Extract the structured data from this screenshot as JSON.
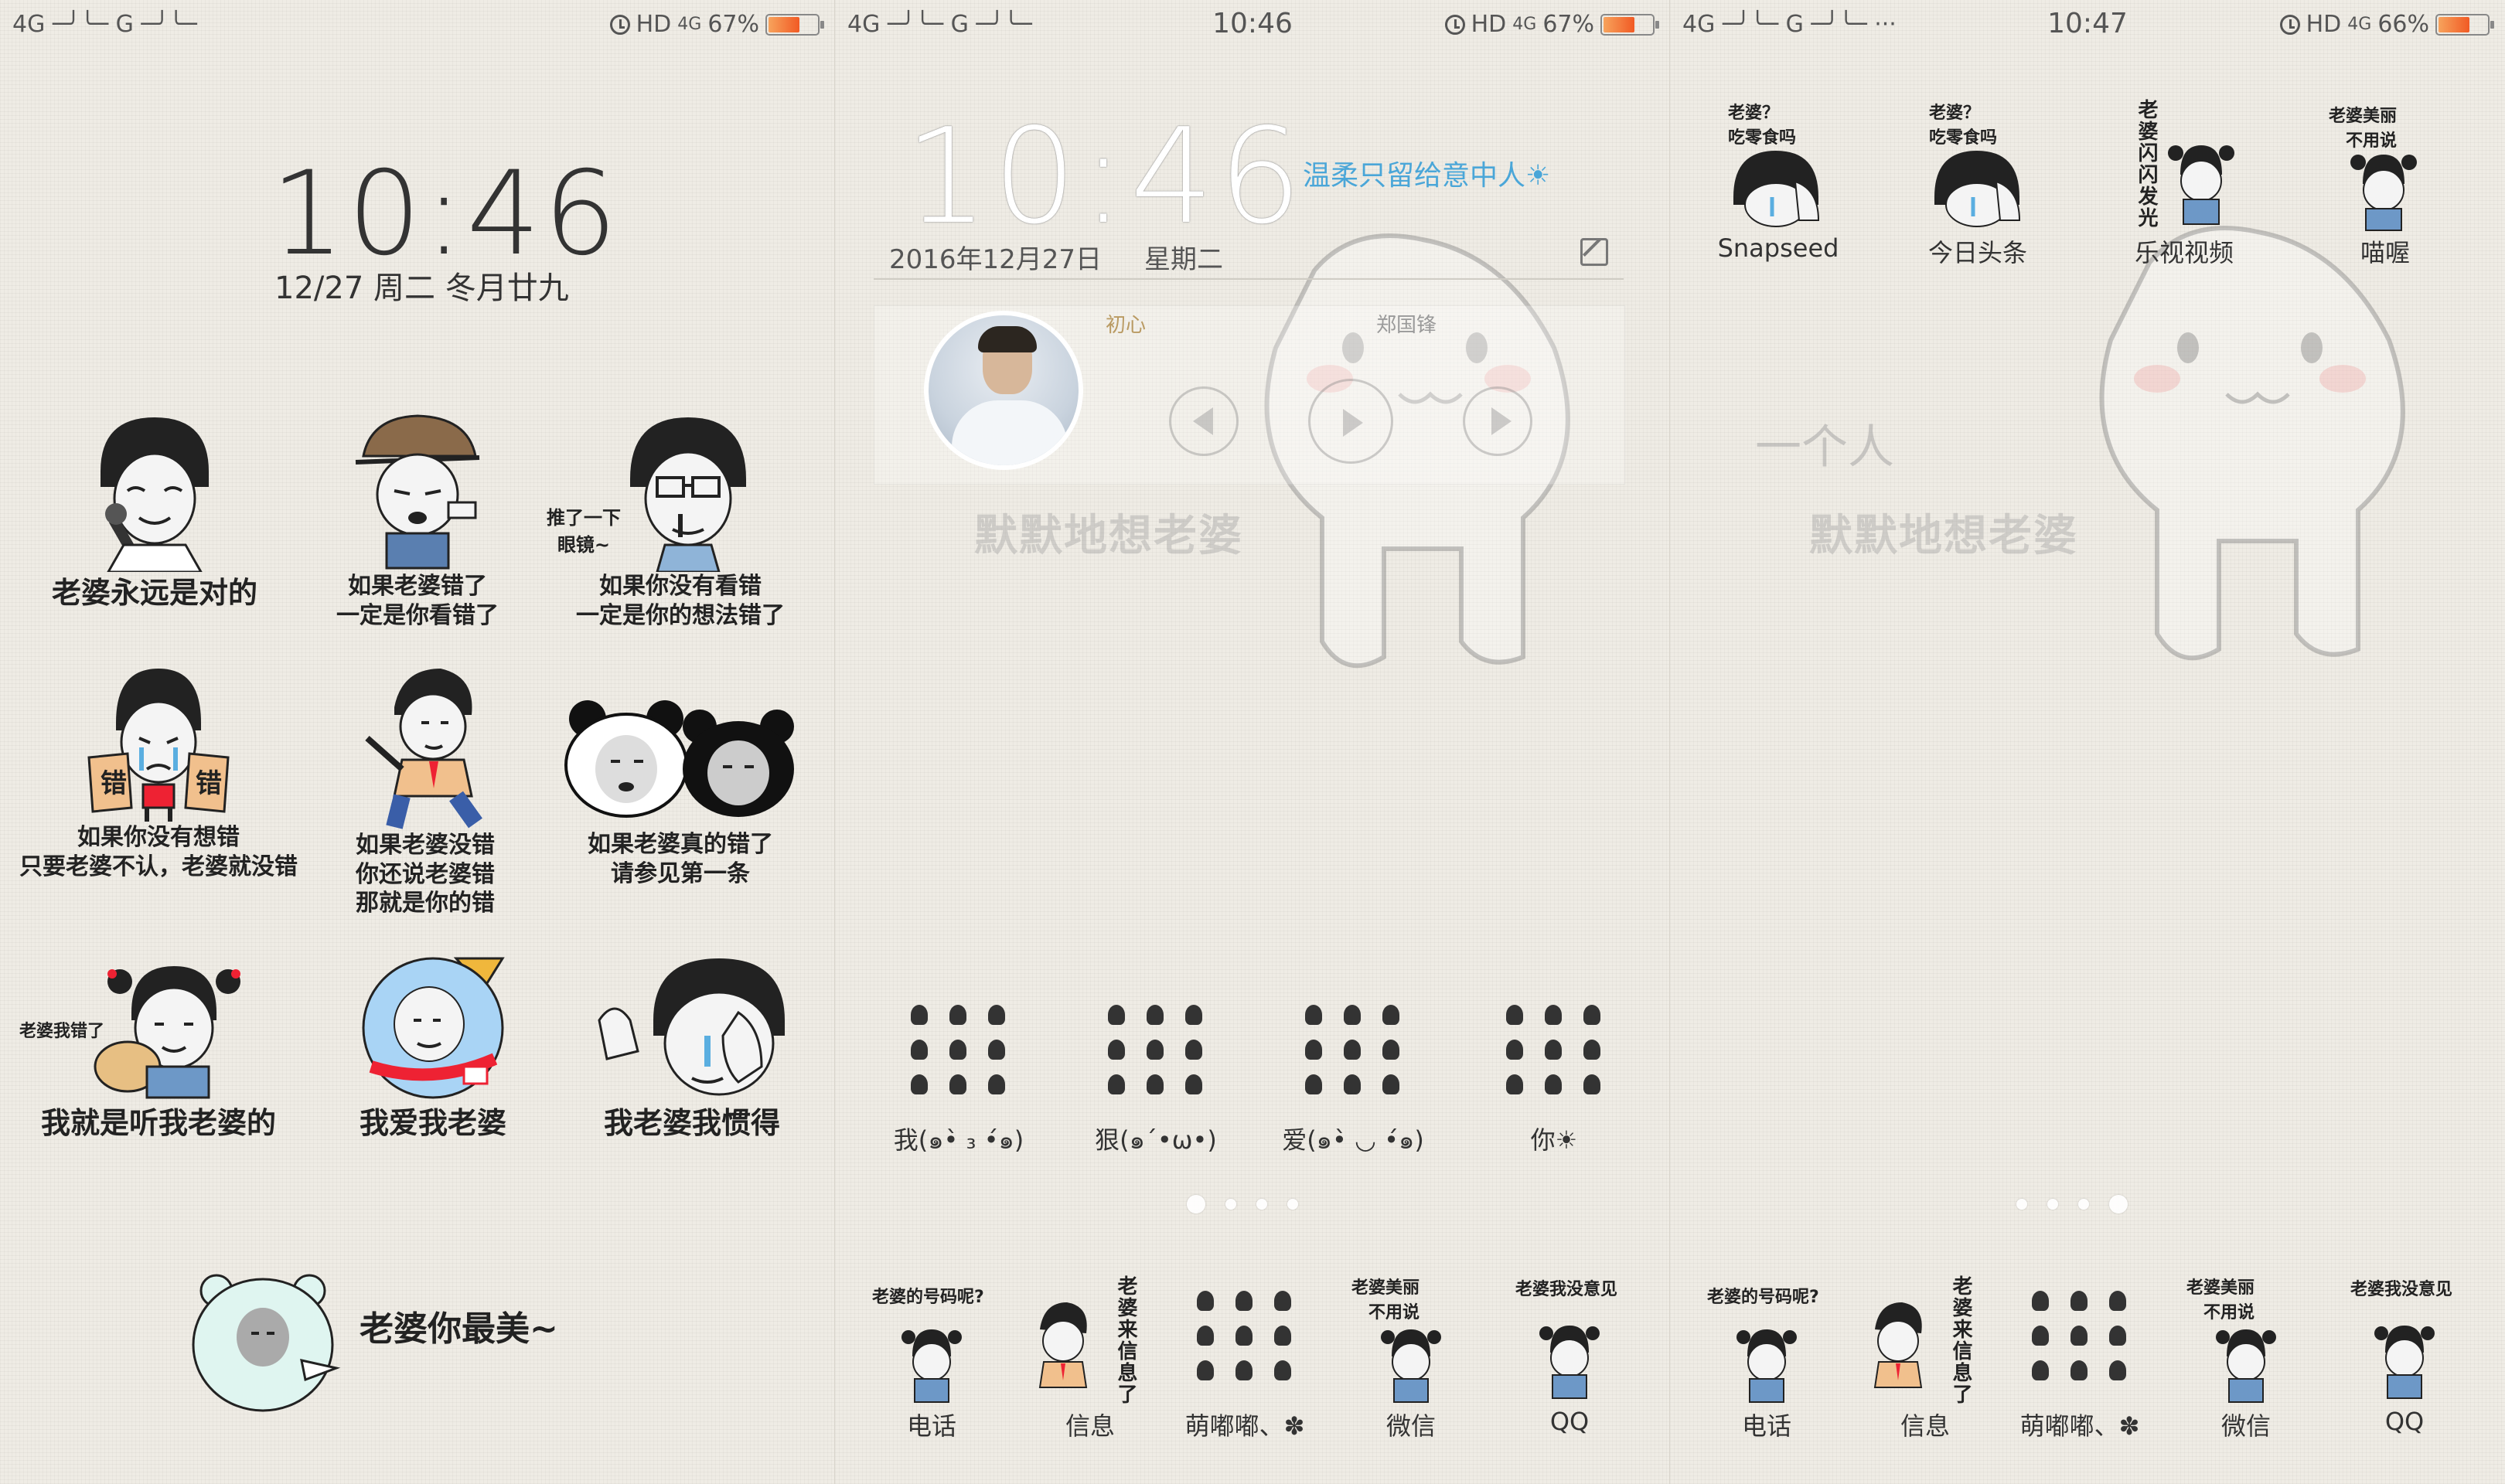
{
  "screens": [
    {
      "status": {
        "signal": "4G ─╯╰─ G ─╯╰─",
        "hd": "HD",
        "net": "4G",
        "battery": "67%",
        "battery_level": 0.67
      },
      "clock": {
        "time": "10:46",
        "date": "12/27 周二 冬月廿九"
      },
      "memes": [
        {
          "caption": "老婆永远是对的"
        },
        {
          "caption": "如果老婆错了\n一定是你看错了"
        },
        {
          "caption": "如果你没有看错\n一定是你的想法错了",
          "side": "推了一下\n眼镜~"
        },
        {
          "caption": "如果你没有想错\n只要老婆不认，老婆就没错",
          "signs": [
            "错",
            "错"
          ]
        },
        {
          "caption": "如果老婆没错\n你还说老婆错\n那就是你的错"
        },
        {
          "caption": "如果老婆真的错了\n请参见第一条"
        },
        {
          "caption": "我就是听我老婆的",
          "side": "老婆我错了"
        },
        {
          "caption": "我爱我老婆"
        },
        {
          "caption": "我老婆我惯得"
        }
      ],
      "footer": {
        "caption": "老婆你最美~"
      }
    },
    {
      "status": {
        "signal": "4G ─╯╰─ G ─╯╰─",
        "time": "10:46",
        "hd": "HD",
        "net": "4G",
        "battery": "67%",
        "battery_level": 0.67
      },
      "clock": "10:46",
      "motto": "温柔只留给意中人☀",
      "date": "2016年12月27日",
      "weekday": "星期二",
      "music": {
        "song": "初心",
        "artist": "郑国锋"
      },
      "watermark": "默默地想老婆",
      "emoji_row": [
        {
          "label": "我(๑•̀ ₃ •́๑)"
        },
        {
          "label": "狠(๑´•ω•)"
        },
        {
          "label": "爱(๑•̀ ◡ •́๑)"
        },
        {
          "label": "你☀"
        }
      ],
      "dock": [
        {
          "label": "电话",
          "top": "老婆的号码呢?"
        },
        {
          "label": "信息",
          "side": "老婆来信息了"
        },
        {
          "label": "萌嘟嘟、✽"
        },
        {
          "label": "微信",
          "top": "老婆美丽\n不用说"
        },
        {
          "label": "QQ",
          "top": "老婆我没意见"
        }
      ]
    },
    {
      "status": {
        "signal": "4G ─╯╰─ G ─╯╰─ ···",
        "time": "10:47",
        "hd": "HD",
        "net": "4G",
        "battery": "66%",
        "battery_level": 0.66
      },
      "apps": [
        {
          "label": "Snapseed",
          "top": "老婆？\n吃零食吗"
        },
        {
          "label": "今日头条",
          "top": "老婆？\n吃零食吗"
        },
        {
          "label": "乐视视频",
          "side": "老婆闪闪发光"
        },
        {
          "label": "喵喔",
          "top": "老婆美丽\n不用说"
        }
      ],
      "yige": "一个人",
      "watermark": "默默地想老婆",
      "dock": [
        {
          "label": "电话",
          "top": "老婆的号码呢?"
        },
        {
          "label": "信息",
          "side": "老婆来信息了"
        },
        {
          "label": "萌嘟嘟、✽"
        },
        {
          "label": "微信",
          "top": "老婆美丽\n不用说"
        },
        {
          "label": "QQ",
          "top": "老婆我没意见"
        }
      ]
    }
  ]
}
